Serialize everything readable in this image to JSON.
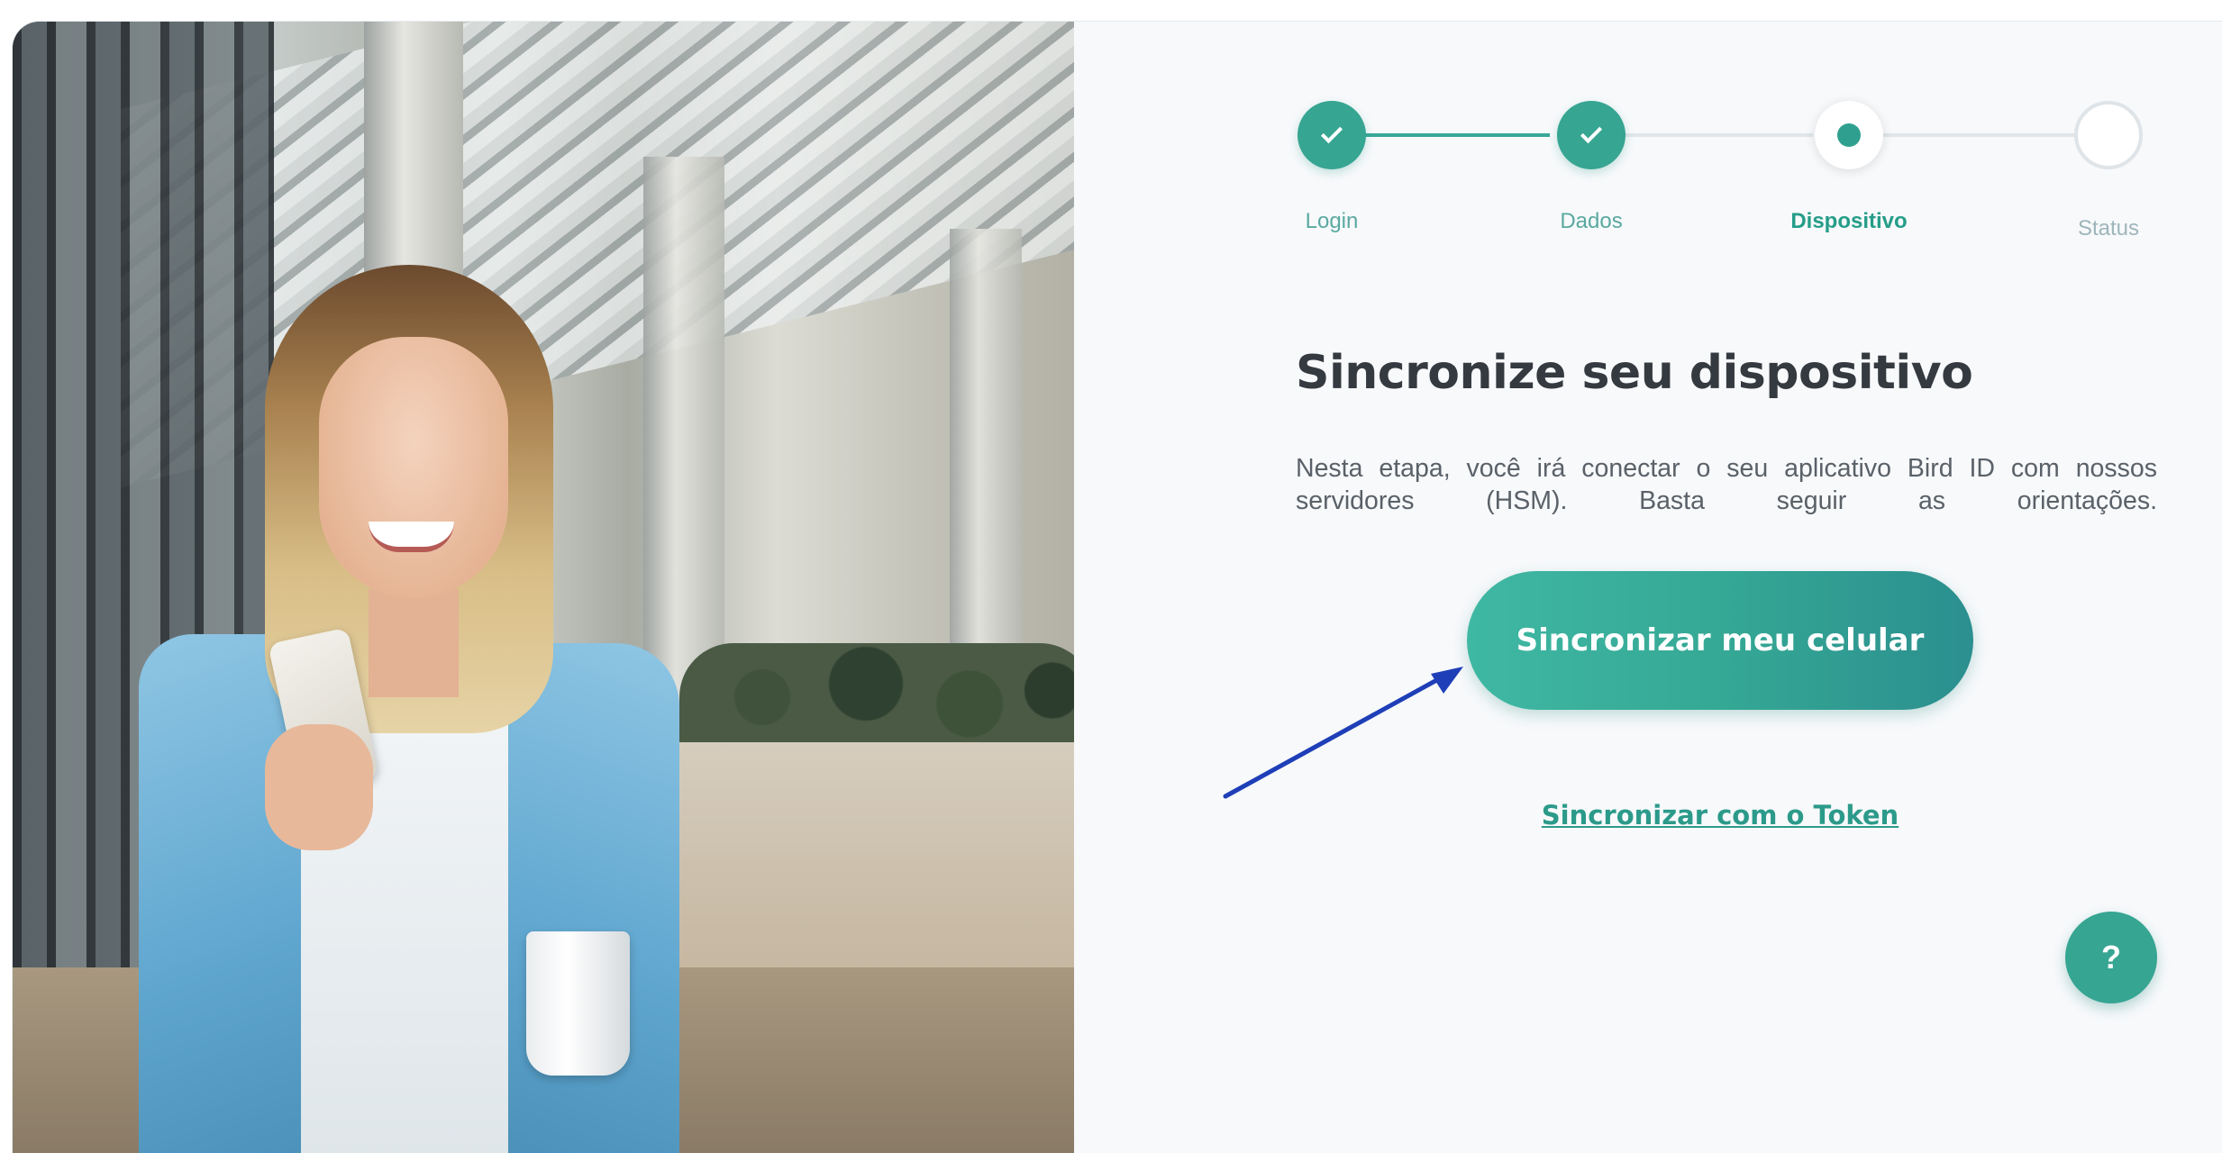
{
  "stepper": {
    "steps": [
      {
        "label": "Login",
        "state": "done"
      },
      {
        "label": "Dados",
        "state": "done"
      },
      {
        "label": "Dispositivo",
        "state": "current"
      },
      {
        "label": "Status",
        "state": "pending"
      }
    ]
  },
  "main": {
    "title": "Sincronize seu dispositivo",
    "description": "Nesta etapa, você irá conectar o seu aplicativo Bird ID com nossos servidores (HSM). Basta seguir as orientações.",
    "primary_button": "Sincronizar meu celular",
    "token_link": "Sincronizar com o Token",
    "help_button": "?"
  },
  "colors": {
    "accent": "#36a592",
    "annotation_arrow": "#1f3fb8"
  }
}
